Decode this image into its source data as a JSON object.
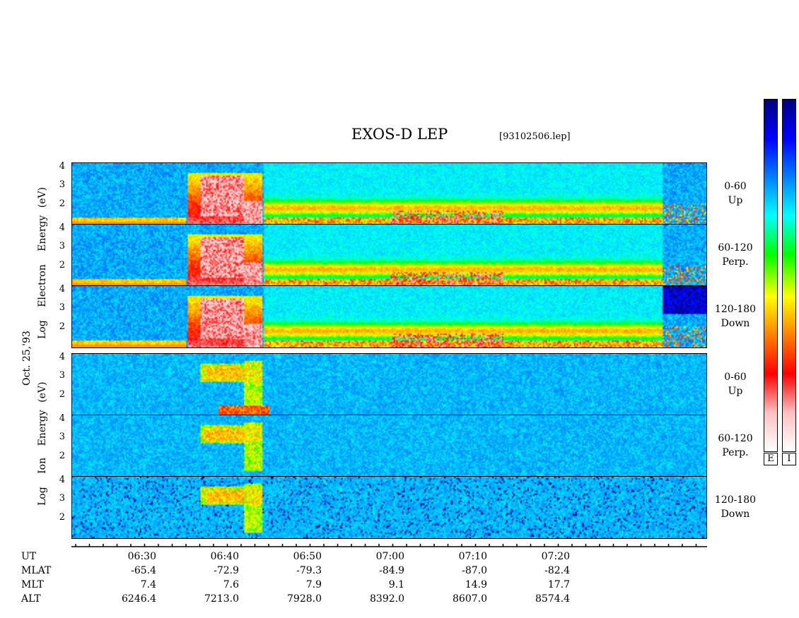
{
  "title": "EXOS-D LEP",
  "filename": "[93102506.lep]",
  "date_label": "Oct. 25,'93",
  "electron_axis_label": [
    "Log",
    "Electron",
    "Energy",
    "(eV)"
  ],
  "ion_axis_label": [
    "Log",
    "Ion",
    "Energy",
    "(eV)"
  ],
  "y_ticks": [
    "4",
    "3",
    "2"
  ],
  "channels": [
    {
      "range": "0-60",
      "dir": "Up"
    },
    {
      "range": "60-120",
      "dir": "Perp."
    },
    {
      "range": "120-180",
      "dir": "Down"
    },
    {
      "range": "0-60",
      "dir": "Up"
    },
    {
      "range": "60-120",
      "dir": "Perp."
    },
    {
      "range": "120-180",
      "dir": "Down"
    }
  ],
  "colorbar_labels": [
    "E",
    "I"
  ],
  "colors": {
    "background_spectrogram": "#0a2ad6",
    "colorbar_stops": [
      "#000080",
      "#0000ff",
      "#0080ff",
      "#00ffff",
      "#00ff00",
      "#ffff00",
      "#ff8000",
      "#ff0000",
      "#ffc0c0",
      "#ffffff"
    ]
  },
  "chart_data": {
    "type": "heatmap",
    "title": "EXOS-D LEP",
    "xlabel": "UT",
    "ylabel": "Log Energy (eV)",
    "ylim": [
      1,
      4
    ],
    "x_tick_labels": [
      "06:30",
      "06:40",
      "06:50",
      "07:00",
      "07:10",
      "07:20"
    ],
    "panels": [
      {
        "species": "Electron",
        "pitch_angle": "0-60",
        "direction": "Up"
      },
      {
        "species": "Electron",
        "pitch_angle": "60-120",
        "direction": "Perp."
      },
      {
        "species": "Electron",
        "pitch_angle": "120-180",
        "direction": "Down"
      },
      {
        "species": "Ion",
        "pitch_angle": "0-60",
        "direction": "Up"
      },
      {
        "species": "Ion",
        "pitch_angle": "60-120",
        "direction": "Perp."
      },
      {
        "species": "Ion",
        "pitch_angle": "120-180",
        "direction": "Down"
      }
    ],
    "ephemeris": {
      "rows": [
        "UT",
        "MLAT",
        "MLT",
        "ALT"
      ],
      "UT": [
        "06:30",
        "06:40",
        "06:50",
        "07:00",
        "07:10",
        "07:20"
      ],
      "MLAT": [
        "-65.4",
        "-72.9",
        "-79.3",
        "-84.9",
        "-87.0",
        "-82.4"
      ],
      "MLT": [
        "7.4",
        "7.6",
        "7.9",
        "9.1",
        "14.9",
        "17.7"
      ],
      "ALT": [
        "6246.4",
        "7213.0",
        "7928.0",
        "8392.0",
        "8607.0",
        "8574.4"
      ]
    }
  }
}
